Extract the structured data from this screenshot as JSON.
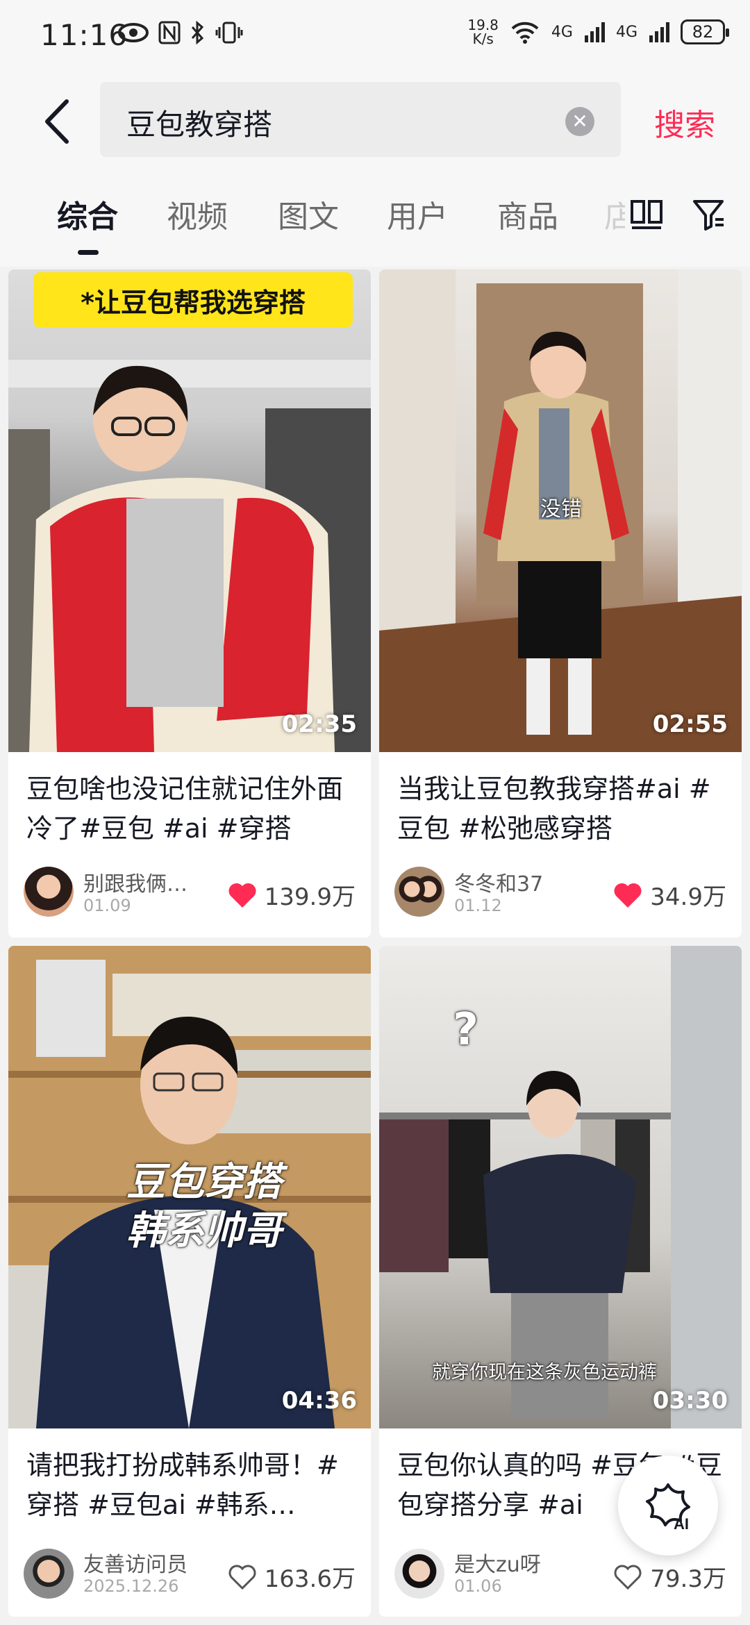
{
  "status_bar": {
    "time": "11:16",
    "net_speed_top": "19.8",
    "net_speed_unit": "K/s",
    "net1": "4G",
    "net2": "4G",
    "battery": "82"
  },
  "search": {
    "query": "豆包教穿搭",
    "submit_label": "搜索"
  },
  "tabs": [
    {
      "label": "综合",
      "active": true
    },
    {
      "label": "视频",
      "active": false
    },
    {
      "label": "图文",
      "active": false
    },
    {
      "label": "用户",
      "active": false
    },
    {
      "label": "商品",
      "active": false
    },
    {
      "label": "店",
      "active": false
    }
  ],
  "results": [
    {
      "overlay_text": "*让豆包帮我选穿搭",
      "duration": "02:35",
      "title": "豆包啥也没记住就记住外面冷了#豆包 #ai #穿搭",
      "author": "别跟我俩…",
      "date": "01.09",
      "likes": "139.9万",
      "liked": true
    },
    {
      "caption": "没错",
      "duration": "02:55",
      "title": "当我让豆包教我穿搭#ai #豆包 #松弛感穿搭",
      "author": "冬冬和37",
      "date": "01.12",
      "likes": "34.9万",
      "liked": true
    },
    {
      "overlay_text": "豆包穿搭\n韩系帅哥",
      "duration": "04:36",
      "title": "请把我打扮成韩系帅哥！#穿搭 #豆包ai #韩系…",
      "author": "友善访问员",
      "date": "2025.12.26",
      "likes": "163.6万",
      "liked": false
    },
    {
      "caption": "就穿你现在这条灰色运动裤",
      "question_mark": "?",
      "duration": "03:30",
      "title": "豆包你认真的吗 #豆包 #豆包穿搭分享 #ai",
      "author": "是大zu呀",
      "date": "01.06",
      "likes": "79.3万",
      "liked": false
    }
  ],
  "ai_button_label": "AI",
  "colors": {
    "accent": "#fe2c55",
    "liked_heart": "#fe2c55"
  }
}
